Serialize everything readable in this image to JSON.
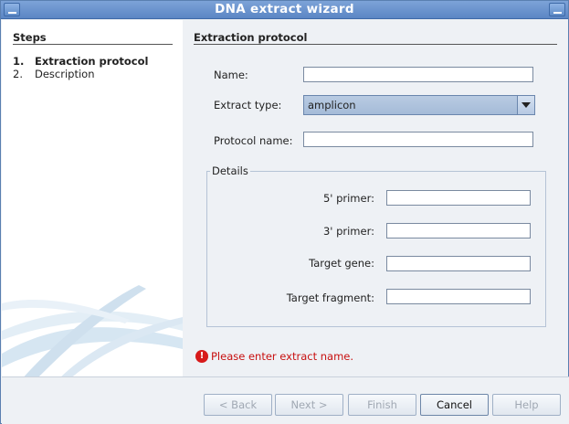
{
  "window": {
    "title": "DNA extract wizard"
  },
  "sidebar": {
    "title": "Steps",
    "steps": [
      {
        "number": "1.",
        "label": "Extraction protocol",
        "active": true
      },
      {
        "number": "2.",
        "label": "Description",
        "active": false
      }
    ]
  },
  "form": {
    "section_title": "Extraction protocol",
    "name": {
      "label": "Name:",
      "value": ""
    },
    "extract_type": {
      "label": "Extract type:",
      "value": "amplicon"
    },
    "protocol_name": {
      "label": "Protocol name:",
      "value": ""
    },
    "details": {
      "legend": "Details",
      "primer5": {
        "label": "5' primer:",
        "value": ""
      },
      "primer3": {
        "label": "3' primer:",
        "value": ""
      },
      "target_gene": {
        "label": "Target gene:",
        "value": ""
      },
      "target_fragment": {
        "label": "Target fragment:",
        "value": ""
      }
    },
    "error_message": "Please enter extract name.",
    "error_icon": "error-icon"
  },
  "buttons": {
    "back": "< Back",
    "next": "Next >",
    "finish": "Finish",
    "cancel": "Cancel",
    "help": "Help"
  },
  "colors": {
    "titlebar": "#5b86c4",
    "error": "#c81010",
    "combo_selected": "#a5bbd8"
  }
}
